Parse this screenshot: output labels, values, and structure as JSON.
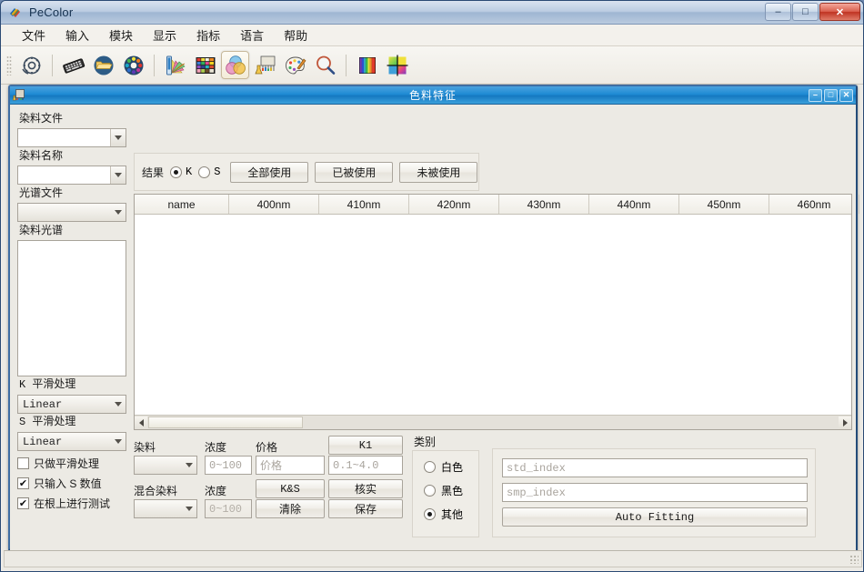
{
  "window": {
    "title": "PeColor",
    "icon": "pecolor-logo-icon",
    "minimize": "–",
    "maximize": "□",
    "close": "✕"
  },
  "menubar": {
    "items": [
      {
        "label": "文件",
        "name": "menu-file"
      },
      {
        "label": "输入",
        "name": "menu-input"
      },
      {
        "label": "模块",
        "name": "menu-module"
      },
      {
        "label": "显示",
        "name": "menu-display"
      },
      {
        "label": "指标",
        "name": "menu-index"
      },
      {
        "label": "语言",
        "name": "menu-language"
      },
      {
        "label": "帮助",
        "name": "menu-help"
      }
    ]
  },
  "toolbar": {
    "buttons": [
      {
        "name": "settings-gear-icon",
        "active": false
      },
      {
        "name": "keyboard-icon",
        "active": false
      },
      {
        "name": "folder-open-icon",
        "active": false
      },
      {
        "name": "color-wheel-icon",
        "active": false
      },
      {
        "name": "color-fan-deck-icon",
        "active": false
      },
      {
        "name": "color-palette-grid-icon",
        "active": false
      },
      {
        "name": "color-mixing-circles-icon",
        "active": true
      },
      {
        "name": "lab-beaker-icon",
        "active": false
      },
      {
        "name": "paint-palette-icon",
        "active": false
      },
      {
        "name": "magnifier-icon",
        "active": false
      },
      {
        "name": "spectrum-bars-icon",
        "active": false
      },
      {
        "name": "color-target-icon",
        "active": false
      }
    ]
  },
  "dialog": {
    "title": "色料特征",
    "icon": "colorant-document-icon",
    "minimize": "–",
    "maximize": "□",
    "close": "✕"
  },
  "left_panel": {
    "dye_file_label": "染料文件",
    "dye_file_value": "",
    "dye_name_label": "染料名称",
    "dye_name_value": "",
    "spectrum_file_label": "光谱文件",
    "spectrum_file_value": "",
    "dye_spectrum_label": "染料光谱",
    "k_smooth_label": "K 平滑处理",
    "k_smooth_value": "Linear",
    "s_smooth_label": "S 平滑处理",
    "s_smooth_value": "Linear",
    "checkboxes": [
      {
        "label": "只做平滑处理",
        "checked": false,
        "mark": ""
      },
      {
        "label": "只输入 S 数值",
        "checked": true,
        "mark": "✔"
      },
      {
        "label": "在根上进行测试",
        "checked": true,
        "mark": "✔"
      }
    ]
  },
  "result_group": {
    "label": "结果",
    "radios": [
      {
        "label": "K",
        "selected": true
      },
      {
        "label": "S",
        "selected": false
      }
    ],
    "buttons": [
      {
        "label": "全部使用",
        "name": "use-all-button"
      },
      {
        "label": "已被使用",
        "name": "used-button"
      },
      {
        "label": "未被使用",
        "name": "unused-button"
      }
    ]
  },
  "table": {
    "columns": [
      "name",
      "400nm",
      "410nm",
      "420nm",
      "430nm",
      "440nm",
      "450nm",
      "460nm"
    ],
    "rows": []
  },
  "bottom_form": {
    "dye_label": "染料",
    "dye_value": "",
    "concentration_label": "浓度",
    "concentration_placeholder": "0~100",
    "price_label": "价格",
    "price_placeholder": "价格",
    "k1_button": "K1",
    "k1_range_placeholder": "0.1~4.0",
    "mixed_dye_label": "混合染料",
    "mixed_dye_value": "",
    "mixed_concentration_label": "浓度",
    "mixed_concentration_placeholder": "0~100",
    "ks_button": "K&S",
    "verify_button": "核实",
    "clear_button": "清除",
    "save_button": "保存"
  },
  "category": {
    "label": "类别",
    "options": [
      {
        "label": "白色",
        "selected": false
      },
      {
        "label": "黑色",
        "selected": false
      },
      {
        "label": "其他",
        "selected": true
      }
    ]
  },
  "index_group": {
    "std_index_placeholder": "std_index",
    "std_index_value": "",
    "smp_index_placeholder": "smp_index",
    "smp_index_value": "",
    "auto_fitting_button": "Auto Fitting"
  },
  "statusbar": {
    "text": ""
  }
}
